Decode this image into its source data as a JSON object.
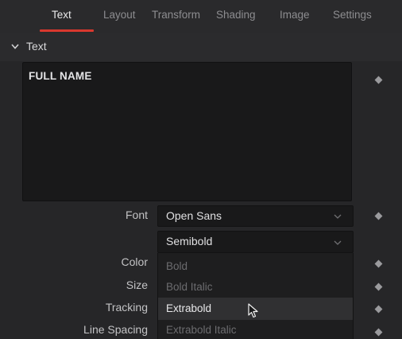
{
  "tabs": [
    {
      "label": "Text",
      "active": true
    },
    {
      "label": "Layout",
      "active": false
    },
    {
      "label": "Transform",
      "active": false
    },
    {
      "label": "Shading",
      "active": false
    },
    {
      "label": "Image",
      "active": false
    },
    {
      "label": "Settings",
      "active": false
    }
  ],
  "accent_color": "#d9382e",
  "section": {
    "title": "Text",
    "expanded": true
  },
  "text_input": {
    "value": "FULL NAME"
  },
  "font": {
    "label": "Font",
    "family": "Open Sans",
    "style": "Semibold",
    "style_options": [
      "Bold",
      "Bold Italic",
      "Extrabold",
      "Extrabold Italic"
    ],
    "hovered_option": "Extrabold"
  },
  "properties": {
    "color_label": "Color",
    "size_label": "Size",
    "tracking_label": "Tracking",
    "line_spacing_label": "Line Spacing"
  },
  "icons": {
    "expand": "chevron-down-icon",
    "keyframe": "keyframe-diamond-icon",
    "caret": "caret-down-icon",
    "cursor": "mouse-pointer-icon"
  }
}
